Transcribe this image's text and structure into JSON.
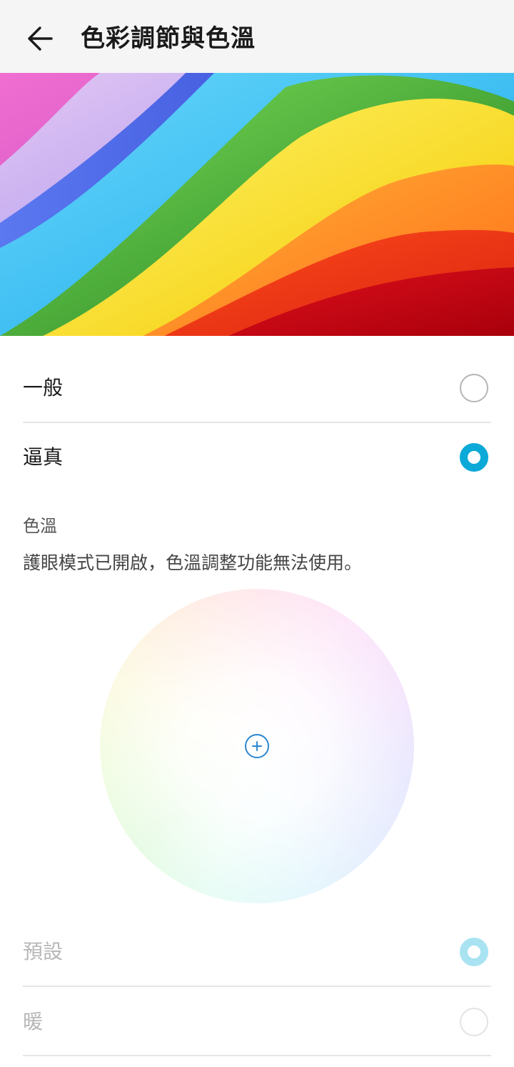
{
  "header": {
    "title": "色彩調節與色溫",
    "back_icon": "arrow-left-icon"
  },
  "color_mode": {
    "options": [
      {
        "label": "一般",
        "selected": false
      },
      {
        "label": "逼真",
        "selected": true
      }
    ]
  },
  "color_temperature": {
    "section_label": "色溫",
    "notice": "護眼模式已開啟，色溫調整功能無法使用。",
    "cursor_icon": "plus-circle-icon",
    "options": [
      {
        "label": "預設",
        "selected": true,
        "disabled": true
      },
      {
        "label": "暖",
        "selected": false,
        "disabled": true
      }
    ]
  },
  "colors": {
    "accent": "#0aa9d8",
    "accent_disabled": "#a9e3f2",
    "title_bar": "#f5f5f5",
    "text_primary": "#1a1a1a",
    "text_disabled": "#b7b7b7",
    "divider": "#e6e6e6"
  }
}
